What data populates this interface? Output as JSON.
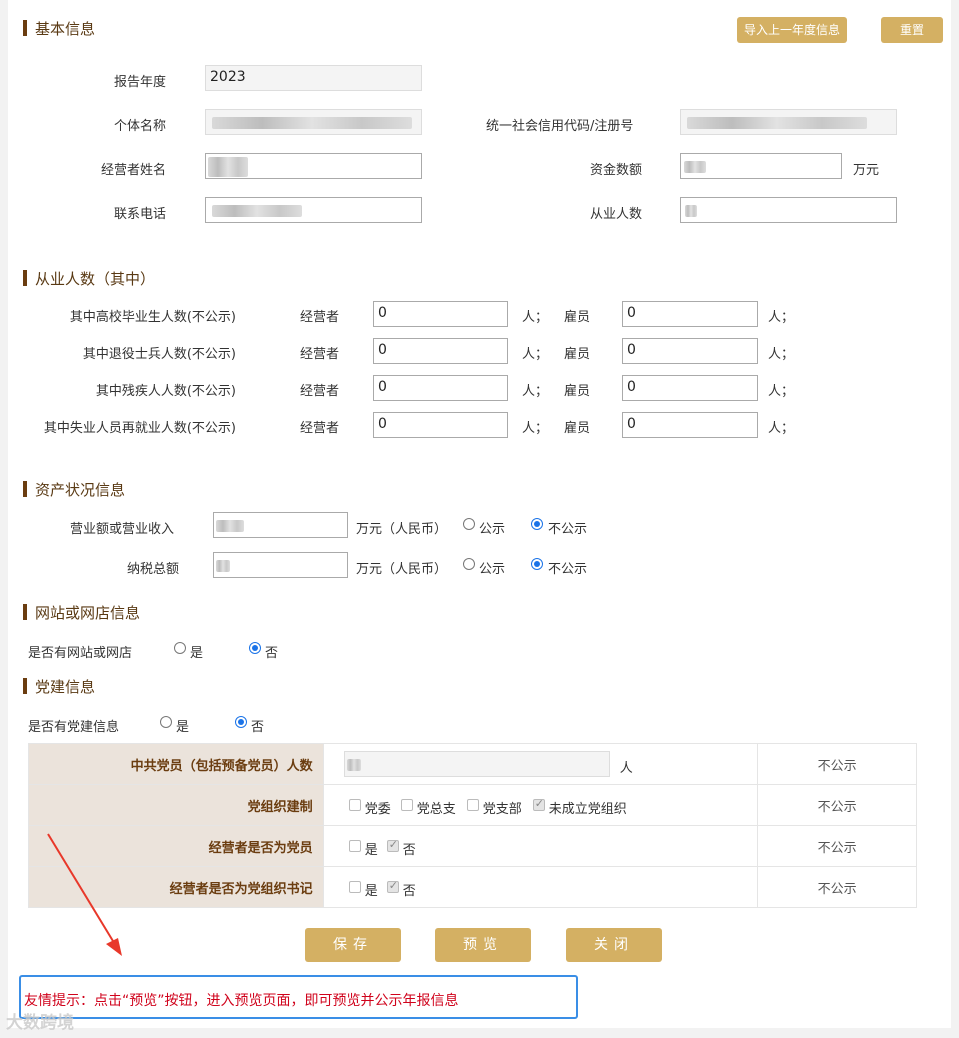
{
  "basic": {
    "title": "基本信息",
    "import_btn": "导入上一年度信息",
    "reset_btn": "重置",
    "year_label": "报告年度",
    "year_value": "2023",
    "name_label": "个体名称",
    "credit_label": "统一社会信用代码/注册号",
    "operator_label": "经营者姓名",
    "capital_label": "资金数额",
    "capital_unit": "万元",
    "phone_label": "联系电话",
    "staff_label": "从业人数"
  },
  "employment": {
    "title": "从业人数（其中）",
    "operator": "经营者",
    "employee": "雇员",
    "unit": "人；",
    "rows": [
      {
        "label": "其中高校毕业生人数(不公示)",
        "op": "0",
        "emp": "0"
      },
      {
        "label": "其中退役士兵人数(不公示)",
        "op": "0",
        "emp": "0"
      },
      {
        "label": "其中残疾人人数(不公示)",
        "op": "0",
        "emp": "0"
      },
      {
        "label": "其中失业人员再就业人数(不公示)",
        "op": "0",
        "emp": "0"
      }
    ]
  },
  "assets": {
    "title": "资产状况信息",
    "unit": "万元（人民币）",
    "public": "公示",
    "not_public": "不公示",
    "rows": [
      {
        "label": "营业额或营业收入"
      },
      {
        "label": "纳税总额"
      }
    ]
  },
  "website": {
    "title": "网站或网店信息",
    "question": "是否有网站或网店",
    "yes": "是",
    "no": "否"
  },
  "party": {
    "title": "党建信息",
    "question": "是否有党建信息",
    "yes": "是",
    "no": "否",
    "table": {
      "members_label": "中共党员（包括预备党员）人数",
      "members_unit": "人",
      "org_label": "党组织建制",
      "org_options": [
        "党委",
        "党总支",
        "党支部",
        "未成立党组织"
      ],
      "is_member_label": "经营者是否为党员",
      "is_secretary_label": "经营者是否为党组织书记",
      "yes": "是",
      "no": "否",
      "not_public": "不公示"
    }
  },
  "actions": {
    "save": "保存",
    "preview": "预览",
    "close": "关闭"
  },
  "tip": "友情提示：点击“预览”按钮，进入预览页面，即可预览并公示年报信息",
  "watermark": "大数跨境",
  "colors": {
    "gold": "#d4b063",
    "brown": "#6b3d10",
    "tip_red": "#d0021b",
    "tip_border": "#3a8ee6",
    "arrow_red": "#e8382a"
  }
}
